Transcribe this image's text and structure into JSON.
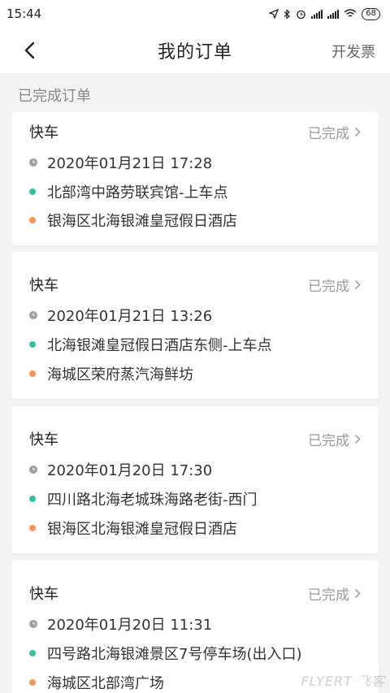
{
  "statusbar": {
    "time": "15:44",
    "battery": "68"
  },
  "nav": {
    "title": "我的订单",
    "action": "开发票"
  },
  "section": {
    "label": "已完成订单"
  },
  "orders": [
    {
      "type": "快车",
      "status": "已完成",
      "time": "2020年01月21日 17:28",
      "from": "北部湾中路劳联宾馆-上车点",
      "to": "银海区北海银滩皇冠假日酒店"
    },
    {
      "type": "快车",
      "status": "已完成",
      "time": "2020年01月21日 13:26",
      "from": "北海银滩皇冠假日酒店东侧-上车点",
      "to": "海城区荣府蒸汽海鲜坊"
    },
    {
      "type": "快车",
      "status": "已完成",
      "time": "2020年01月20日 17:30",
      "from": "四川路北海老城珠海路老街-西门",
      "to": "银海区北海银滩皇冠假日酒店"
    },
    {
      "type": "快车",
      "status": "已完成",
      "time": "2020年01月20日 11:31",
      "from": "四号路北海银滩景区7号停车场(出入口)",
      "to": "海城区北部湾广场"
    }
  ],
  "watermark": "FLYERT 飞客",
  "colors": {
    "origin_dot": "#35c1a4",
    "destination_dot": "#f7945a",
    "background": "#f3f3f3"
  }
}
